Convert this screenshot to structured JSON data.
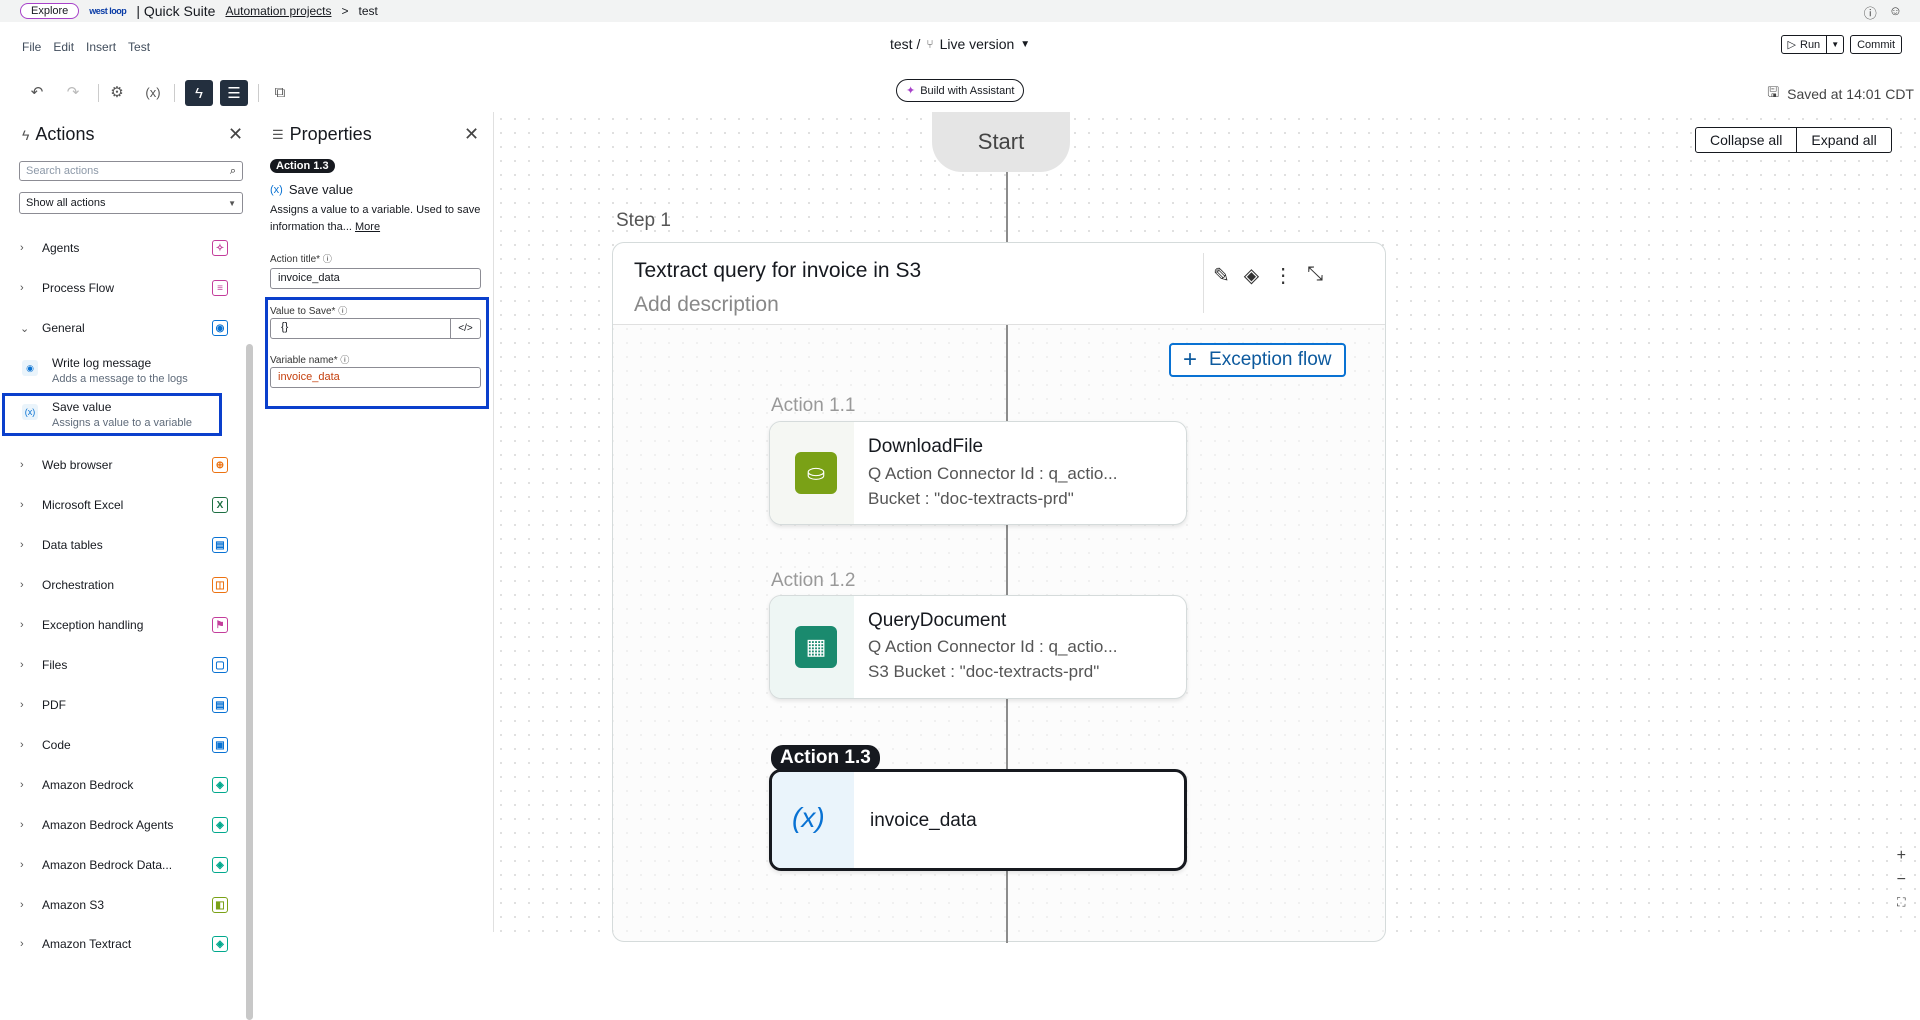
{
  "topbar": {
    "explore": "Explore",
    "brand": "west loop",
    "app": "| Quick Suite",
    "breadcrumb_projects": "Automation projects",
    "breadcrumb_sep": ">",
    "breadcrumb_current": "test",
    "help_icon": "?",
    "user_icon": "user"
  },
  "menu": [
    "File",
    "Edit",
    "Insert",
    "Test"
  ],
  "title": {
    "project": "test /",
    "version": "Live version"
  },
  "run": {
    "run_label": "Run",
    "commit_label": "Commit"
  },
  "toolbar": {
    "assistant": "Build with Assistant",
    "saved": "Saved at 14:01 CDT"
  },
  "actions_panel": {
    "title": "Actions",
    "search_placeholder": "Search actions",
    "filter": "Show all actions",
    "categories": [
      {
        "label": "Agents",
        "color": "#c33d9b",
        "glyph": "✧"
      },
      {
        "label": "Process Flow",
        "color": "#c33d9b",
        "glyph": "≡"
      },
      {
        "label": "General",
        "color": "#0972d3",
        "glyph": "◉"
      },
      {
        "label": "Web browser",
        "color": "#ec7211",
        "glyph": "⊕"
      },
      {
        "label": "Microsoft Excel",
        "color": "#1d6f42",
        "glyph": "X"
      },
      {
        "label": "Data tables",
        "color": "#0972d3",
        "glyph": "▤"
      },
      {
        "label": "Orchestration",
        "color": "#ec7211",
        "glyph": "◫"
      },
      {
        "label": "Exception handling",
        "color": "#c33d9b",
        "glyph": "⚑"
      },
      {
        "label": "Files",
        "color": "#0972d3",
        "glyph": "▢"
      },
      {
        "label": "PDF",
        "color": "#0972d3",
        "glyph": "▤"
      },
      {
        "label": "Code",
        "color": "#0972d3",
        "glyph": "▣"
      },
      {
        "label": "Amazon Bedrock",
        "color": "#01a88d",
        "glyph": "◈"
      },
      {
        "label": "Amazon Bedrock Agents",
        "color": "#01a88d",
        "glyph": "◈"
      },
      {
        "label": "Amazon Bedrock Data...",
        "color": "#01a88d",
        "glyph": "◈"
      },
      {
        "label": "Amazon S3",
        "color": "#7aa116",
        "glyph": "◧"
      },
      {
        "label": "Amazon Textract",
        "color": "#01a88d",
        "glyph": "◈"
      }
    ],
    "general_items": [
      {
        "title": "Write log message",
        "desc": "Adds a message to the logs"
      },
      {
        "title": "Save value",
        "desc": "Assigns a value to a variable"
      }
    ]
  },
  "properties": {
    "title": "Properties",
    "badge": "Action 1.3",
    "action_name": "Save value",
    "desc": "Assigns a value to a variable. Used to save information tha...",
    "more": "More",
    "action_title_label": "Action title*",
    "action_title_value": "invoice_data",
    "value_label": "Value to Save*",
    "value_value": "{}",
    "code_btn": "</>",
    "var_label": "Variable name*",
    "var_value": "invoice_data"
  },
  "canvas": {
    "start": "Start",
    "collapse_all": "Collapse all",
    "expand_all": "Expand all",
    "step_label": "Step 1",
    "step_title": "Textract query for invoice in S3",
    "step_desc": "Add description",
    "exception_flow": "Exception flow",
    "actions": [
      {
        "label": "Action 1.1",
        "title": "DownloadFile",
        "line1": "Q Action Connector Id : q_actio...",
        "line2": "Bucket : \"doc-textracts-prd\""
      },
      {
        "label": "Action 1.2",
        "title": "QueryDocument",
        "line1": "Q Action Connector Id : q_actio...",
        "line2": "S3 Bucket : \"doc-textracts-prd\""
      },
      {
        "label": "Action 1.3",
        "title": "invoice_data"
      }
    ]
  }
}
